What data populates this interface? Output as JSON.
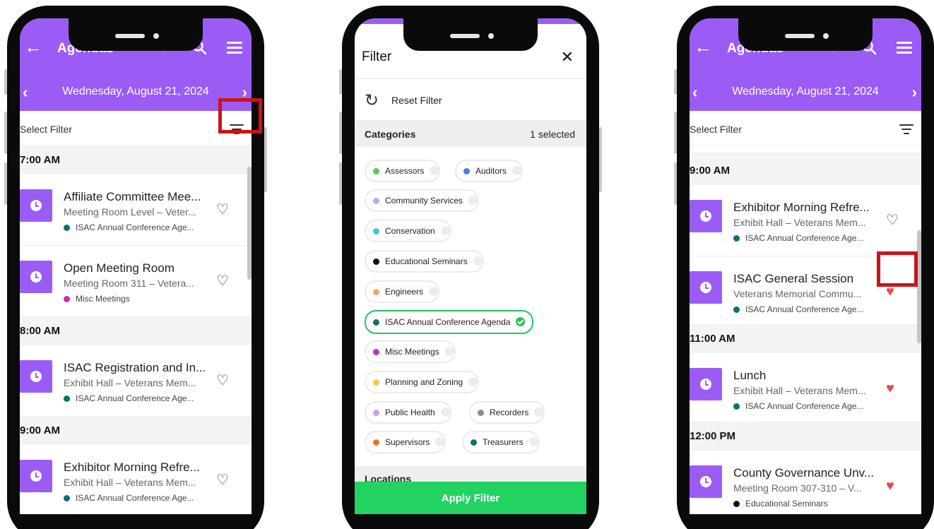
{
  "colors": {
    "accent": "#9b5cf6",
    "apply": "#22d362",
    "selected": "#22c55e",
    "highlight": "#c8151b",
    "fav_on": "#e74c4c"
  },
  "icons": {
    "back": "arrow-left-icon",
    "favorites": "heart-outline-icon",
    "search": "magnifier-icon",
    "menu": "hamburger-icon",
    "filter": "filter-lines-icon",
    "reset": "refresh-icon",
    "close": "close-x-icon",
    "session": "clock-icon"
  },
  "glyphs": {
    "back": "←",
    "heart_outline": "♡",
    "heart_filled": "♥",
    "prev": "‹",
    "next": "›",
    "close": "✕",
    "reset": "↻"
  },
  "phone1": {
    "header": {
      "title": "Agendas",
      "date": "Wednesday, August 21, 2024"
    },
    "filter_label": "Select Filter",
    "groups": [
      {
        "time": "7:00 AM",
        "items": [
          {
            "title": "Affiliate Committee Mee...",
            "location": "Meeting Room Level – Veter...",
            "category": "ISAC Annual Conference Age...",
            "dot": "#0f6e6e",
            "favorited": false
          }
        ]
      },
      {
        "time": "",
        "items": [
          {
            "title": "Open Meeting Room",
            "location": "Meeting Room 311 – Vetera...",
            "category": "Misc Meetings",
            "dot": "#c42fbd",
            "favorited": false
          }
        ]
      },
      {
        "time": "8:00 AM",
        "items": [
          {
            "title": "ISAC Registration and In...",
            "location": "Exhibit Hall – Veterans Mem...",
            "category": "ISAC Annual Conference Age...",
            "dot": "#0f6e6e",
            "favorited": false
          }
        ]
      },
      {
        "time": "9:00 AM",
        "items": [
          {
            "title": "Exhibitor Morning Refre...",
            "location": "Exhibit Hall – Veterans Mem...",
            "category": "ISAC Annual Conference Age...",
            "dot": "#0f6e6e",
            "favorited": false
          }
        ]
      }
    ]
  },
  "phone2": {
    "title": "Filter",
    "reset_label": "Reset Filter",
    "categories_label": "Categories",
    "selected_count": "1 selected",
    "categories": [
      {
        "label": "Assessors",
        "dot": "#5ac85a",
        "selected": false
      },
      {
        "label": "Auditors",
        "dot": "#4a7be0",
        "selected": false
      },
      {
        "label": "Community Services",
        "dot": "#a9b4f0",
        "selected": false
      },
      {
        "label": "Conservation",
        "dot": "#3ec5d8",
        "selected": false
      },
      {
        "label": "Educational Seminars",
        "dot": "#111111",
        "selected": false
      },
      {
        "label": "Engineers",
        "dot": "#f4a56a",
        "selected": false
      },
      {
        "label": "ISAC Annual Conference Agenda",
        "dot": "#0f6e6e",
        "selected": true
      },
      {
        "label": "Misc Meetings",
        "dot": "#c42fbd",
        "selected": false
      },
      {
        "label": "Planning and Zoning",
        "dot": "#f2cb4a",
        "selected": false
      },
      {
        "label": "Public Health",
        "dot": "#c89cf0",
        "selected": false
      },
      {
        "label": "Recorders",
        "dot": "#8a8a8a",
        "selected": false
      },
      {
        "label": "Supervisors",
        "dot": "#e07b1a",
        "selected": false
      },
      {
        "label": "Treasurers",
        "dot": "#0f6e6e",
        "selected": false
      }
    ],
    "locations_label": "Locations",
    "apply_label": "Apply Filter"
  },
  "phone3": {
    "header": {
      "title": "Agendas",
      "date": "Wednesday, August 21, 2024"
    },
    "filter_label": "Select Filter",
    "groups": [
      {
        "time": "9:00 AM",
        "items": [
          {
            "title": "Exhibitor Morning Refre...",
            "location": "Exhibit Hall – Veterans Mem...",
            "category": "ISAC Annual Conference Age...",
            "dot": "#0f6e6e",
            "favorited": false
          },
          {
            "title": "ISAC General Session",
            "location": "Veterans Memorial Commu...",
            "category": "ISAC Annual Conference Age...",
            "dot": "#0f6e6e",
            "favorited": true
          }
        ]
      },
      {
        "time": "11:00 AM",
        "items": [
          {
            "title": "Lunch",
            "location": "Exhibit Hall – Veterans Mem...",
            "category": "ISAC Annual Conference Age...",
            "dot": "#0f6e6e",
            "favorited": true
          }
        ]
      },
      {
        "time": "12:00 PM",
        "items": [
          {
            "title": "County Governance Unv...",
            "location": "Meeting Room 307-310 – V...",
            "category": "Educational Seminars",
            "dot": "#111111",
            "favorited": true
          }
        ]
      }
    ]
  }
}
